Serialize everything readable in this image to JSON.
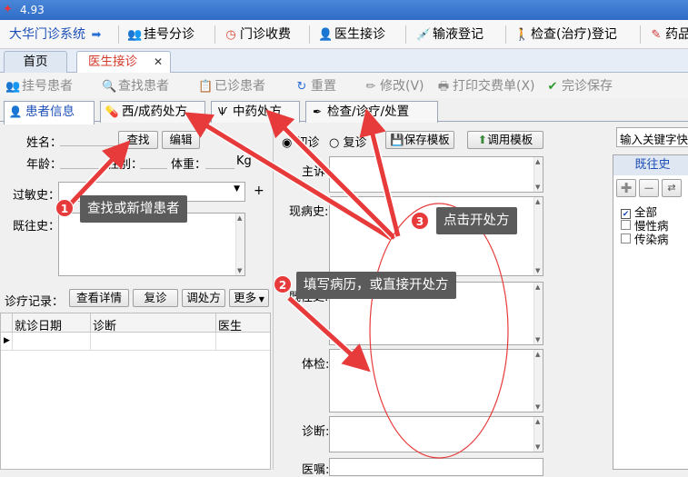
{
  "window": {
    "title": "4.93"
  },
  "menubar": {
    "items": [
      {
        "label": "大华门诊系统",
        "icon": "arrow-right-icon"
      },
      {
        "label": "挂号分诊",
        "icon": "users-icon"
      },
      {
        "label": "门诊收费",
        "icon": "clock-icon"
      },
      {
        "label": "医生接诊",
        "icon": "doctor-icon"
      },
      {
        "label": "输液登记",
        "icon": "syringe-icon"
      },
      {
        "label": "检查(治疗)登记",
        "icon": "walker-icon"
      },
      {
        "label": "药品",
        "icon": "pen-icon"
      }
    ]
  },
  "tabs": {
    "home": "首页",
    "doctor": "医生接诊",
    "close": "✕"
  },
  "toolbar": {
    "register_patient": "挂号患者",
    "find_patient": "查找患者",
    "diagnosed_patient": "已诊患者",
    "reset": "重置",
    "modify": "修改(V)",
    "print_slip": "打印交费单(X)",
    "finish_save": "完诊保存"
  },
  "subtabs": {
    "patient_info": "患者信息",
    "western_rx": "西/成药处方",
    "chinese_rx": "中药处方",
    "exam": "检查/诊疗/处置"
  },
  "patient": {
    "name_label": "姓名：",
    "search_btn": "查找",
    "edit_btn": "编辑",
    "age_label": "年龄：",
    "sex_label": "性别：",
    "weight_label": "体重：",
    "weight_unit": "Kg",
    "allergy_label": "过敏史：",
    "allergy_add": "+",
    "history_label": "既往史：",
    "records_label": "诊疗记录：",
    "view_detail": "查看详情",
    "revisit": "复诊",
    "adjust_rx": "调处方",
    "more": "更多",
    "table_headers": [
      "就诊日期",
      "诊断",
      "医生"
    ]
  },
  "record": {
    "first_visit": "初诊",
    "revisit": "复诊",
    "save_template": "保存模板",
    "load_template": "调用模板",
    "chief": "主诉",
    "present": "现病史:",
    "past": "既往史:",
    "exam": "体检:",
    "diagnosis": "诊断:",
    "advice": "医嘱:"
  },
  "history_panel": {
    "keyword_placeholder": "输入关键字快",
    "title": "既往史",
    "tree": [
      "全部",
      "慢性病",
      "传染病"
    ]
  },
  "annotations": [
    {
      "num": "1",
      "text": "查找或新增患者"
    },
    {
      "num": "2",
      "text": "填写病历，或直接开处方"
    },
    {
      "num": "3",
      "text": "点击开处方"
    }
  ]
}
